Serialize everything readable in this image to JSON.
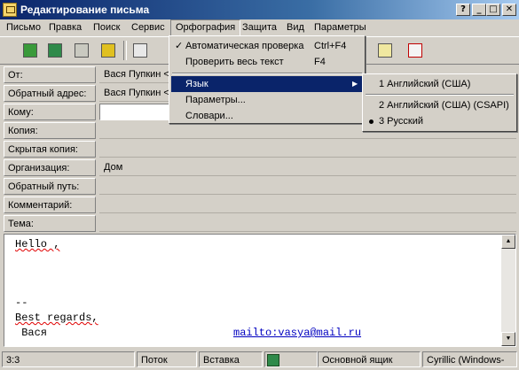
{
  "window": {
    "title": "Редактирование письма",
    "buttons": [
      "?",
      "_",
      "□",
      "✕"
    ]
  },
  "menubar": [
    "Письмо",
    "Правка",
    "Поиск",
    "Сервис",
    "Орфография",
    "Защита",
    "Вид",
    "Параметры"
  ],
  "toolbar": {
    "icons": [
      "send-icon",
      "send-later-icon",
      "hourglass-icon",
      "save-icon",
      "copy-icon",
      "paste-icon",
      "spellcheck-icon",
      "delete-icon"
    ]
  },
  "fields": [
    {
      "label": "От:",
      "value": "Вася Пупкин <"
    },
    {
      "label": "Обратный адрес:",
      "value": "Вася Пупкин <"
    },
    {
      "label": "Кому:",
      "value": ""
    },
    {
      "label": "Копия:",
      "value": ""
    },
    {
      "label": "Скрытая копия:",
      "value": ""
    },
    {
      "label": "Организация:",
      "value": "Дом"
    },
    {
      "label": "Обратный путь:",
      "value": ""
    },
    {
      "label": "Комментарий:",
      "value": ""
    },
    {
      "label": "Тема:",
      "value": ""
    }
  ],
  "body": {
    "line1": "Hello ,",
    "line2": "--",
    "line3": "Best regards,",
    "line4": " Вася",
    "link": "mailto:vasya@mail.ru"
  },
  "status": {
    "pos": "3:3",
    "mode1": "Поток",
    "mode2": "Вставка",
    "mailbox": "Основной ящик",
    "charset": "Cyrillic (Windows-"
  },
  "spell_menu": {
    "auto_check": "Автоматическая проверка",
    "auto_check_shortcut": "Ctrl+F4",
    "check_all": "Проверить весь текст",
    "check_all_shortcut": "F4",
    "language": "Язык",
    "params": "Параметры...",
    "dicts": "Словари..."
  },
  "lang_menu": [
    "1 Английский (США)",
    "2 Английский (США) (CSAPI)",
    "3 Русский"
  ],
  "colors": {
    "title_start": "#0a246a",
    "highlight": "#0a246a",
    "face": "#d4d0c8"
  }
}
